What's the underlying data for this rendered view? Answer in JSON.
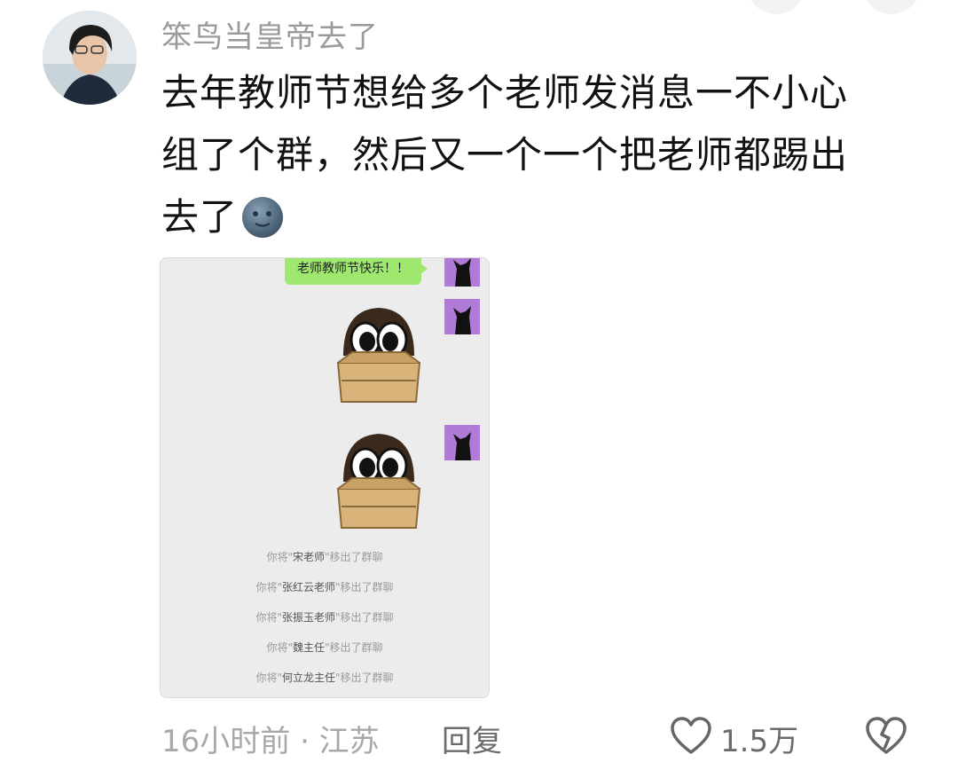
{
  "comment": {
    "username": "笨鸟当皇帝去了",
    "lines": [
      "去年教师节想给多个老师发消息一不小心",
      "组了个群，然后又一个一个把老师都踢出",
      "去了"
    ],
    "emoji": "new-moon-face-icon"
  },
  "screenshot": {
    "message": "老师教师节快乐！！",
    "removals": [
      {
        "prefix": "你将\"",
        "name": "宋老师",
        "suffix": "\"移出了群聊"
      },
      {
        "prefix": "你将\"",
        "name": "张红云老师",
        "suffix": "\"移出了群聊"
      },
      {
        "prefix": "你将\"",
        "name": "张振玉老师",
        "suffix": "\"移出了群聊"
      },
      {
        "prefix": "你将\"",
        "name": "魏主任",
        "suffix": "\"移出了群聊"
      },
      {
        "prefix": "你将\"",
        "name": "何立龙主任",
        "suffix": "\"移出了群聊"
      }
    ]
  },
  "footer": {
    "meta": "16小时前 · 江苏",
    "reply": "回复",
    "likes": "1.5万"
  },
  "colors": {
    "bubble": "#9fe870",
    "avatar_accent": "#b07ad6"
  }
}
